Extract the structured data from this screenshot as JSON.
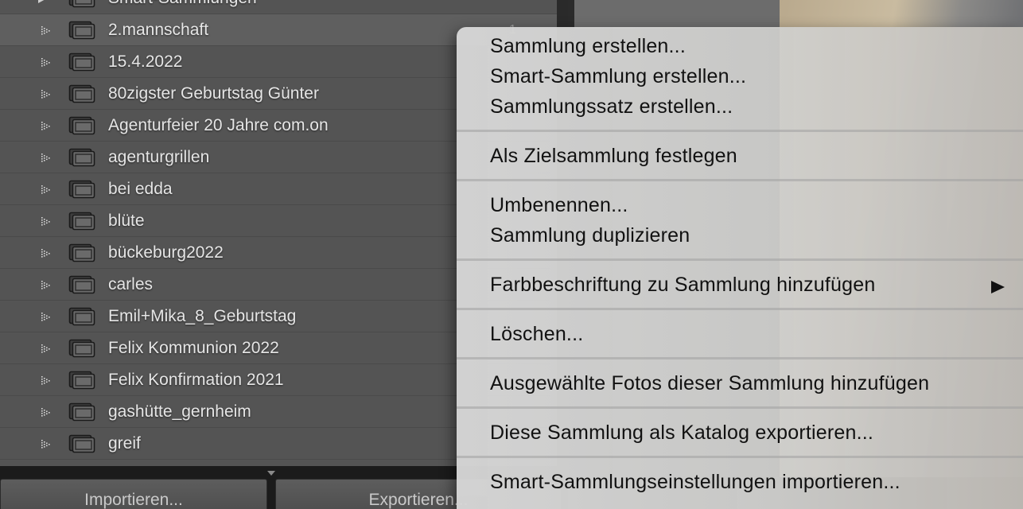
{
  "panel": {
    "collections": [
      {
        "label": "Smart-Sammlungen",
        "expander": "filled",
        "count": ""
      },
      {
        "label": "2.mannschaft",
        "expander": "dotted",
        "count": "1",
        "selected": true
      },
      {
        "label": "15.4.2022",
        "expander": "dotted",
        "count": ""
      },
      {
        "label": "80zigster Geburtstag Günter",
        "expander": "dotted",
        "count": ""
      },
      {
        "label": "Agenturfeier 20 Jahre com.on",
        "expander": "dotted",
        "count": ""
      },
      {
        "label": "agenturgrillen",
        "expander": "dotted",
        "count": ""
      },
      {
        "label": "bei edda",
        "expander": "dotted",
        "count": ""
      },
      {
        "label": "blüte",
        "expander": "dotted",
        "count": ""
      },
      {
        "label": "bückeburg2022",
        "expander": "dotted",
        "count": ""
      },
      {
        "label": "carles",
        "expander": "dotted",
        "count": ""
      },
      {
        "label": "Emil+Mika_8_Geburtstag",
        "expander": "dotted",
        "count": ""
      },
      {
        "label": "Felix Kommunion 2022",
        "expander": "dotted",
        "count": ""
      },
      {
        "label": "Felix Konfirmation 2021",
        "expander": "dotted",
        "count": ""
      },
      {
        "label": "gashütte_gernheim",
        "expander": "dotted",
        "count": ""
      },
      {
        "label": "greif",
        "expander": "dotted",
        "count": ""
      }
    ],
    "icons": {
      "expander": "disclosure-triangle-icon",
      "collection": "collection-stack-icon"
    }
  },
  "bottom_bar": {
    "import_label": "Importieren...",
    "export_label": "Exportieren..."
  },
  "context_menu": {
    "groups": [
      [
        "Sammlung erstellen...",
        "Smart-Sammlung erstellen...",
        "Sammlungssatz erstellen..."
      ],
      [
        "Als Zielsammlung festlegen"
      ],
      [
        "Umbenennen...",
        "Sammlung duplizieren"
      ],
      [
        "Farbbeschriftung zu Sammlung hinzufügen"
      ],
      [
        "Löschen..."
      ],
      [
        "Ausgewählte Fotos dieser Sammlung hinzufügen"
      ],
      [
        "Diese Sammlung als Katalog exportieren..."
      ],
      [
        "Smart-Sammlungseinstellungen importieren..."
      ]
    ],
    "submenu_item": "Farbbeschriftung zu Sammlung hinzufügen"
  },
  "colors": {
    "panel_bg": "#545454",
    "menu_text": "#111111",
    "row_text": "#e6e6e6"
  }
}
